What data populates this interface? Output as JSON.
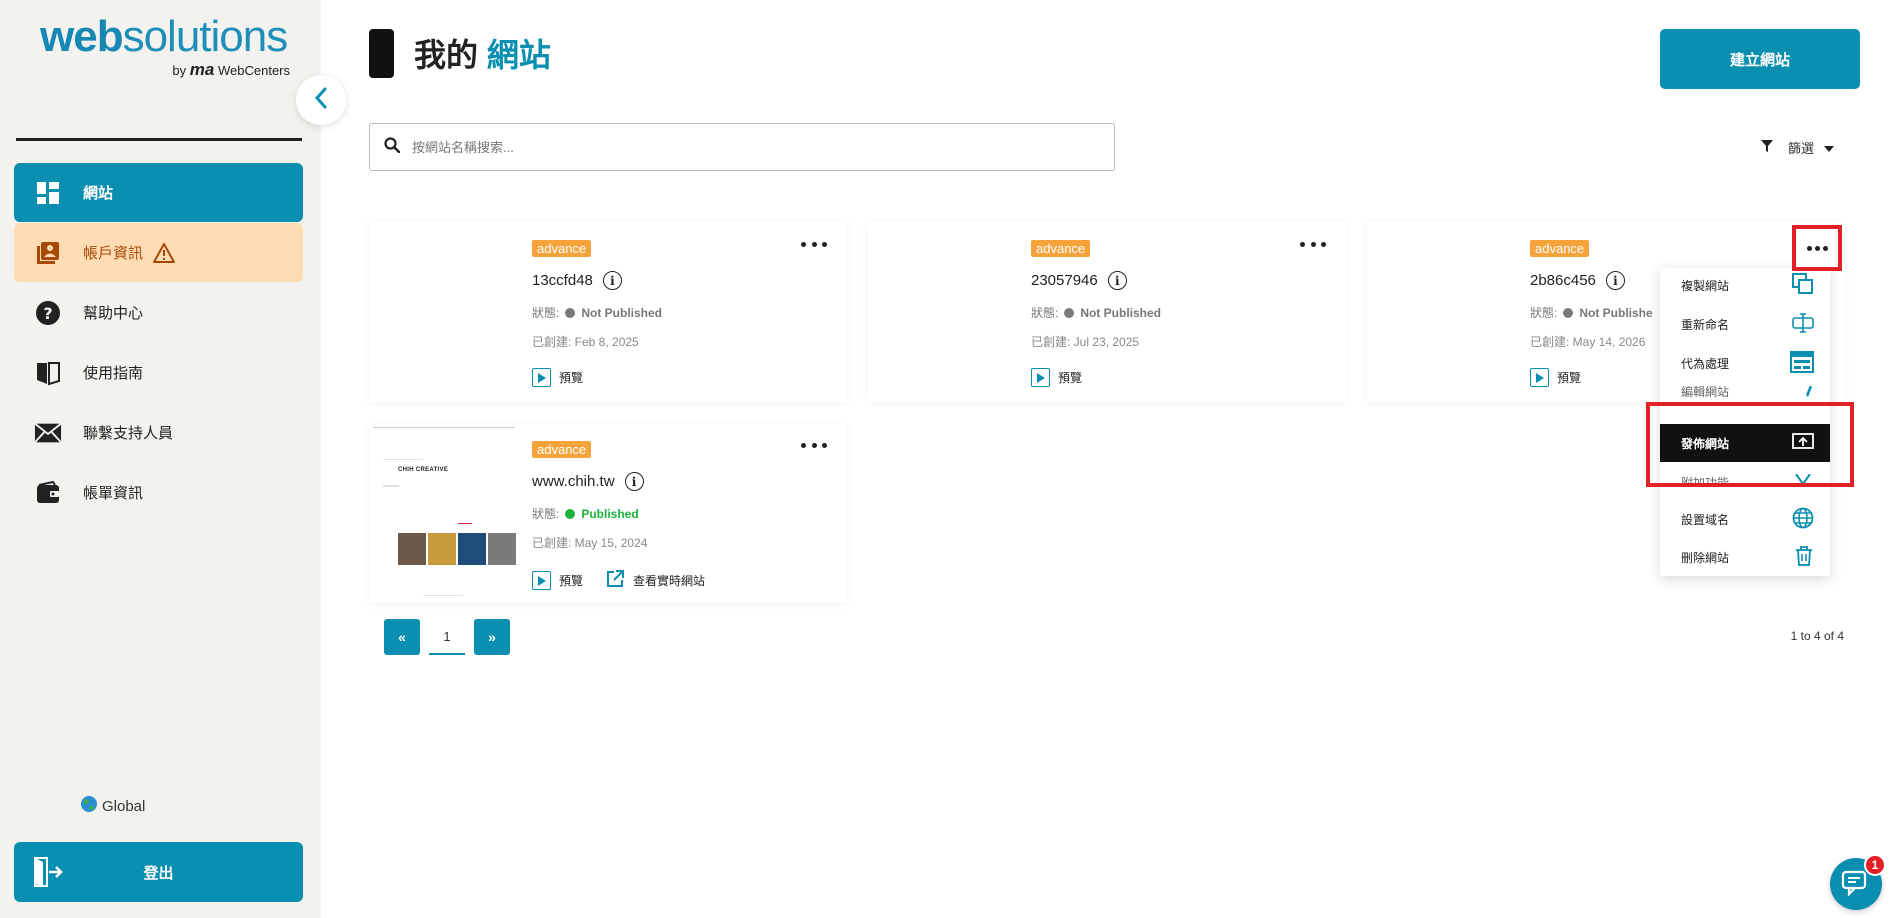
{
  "sidebar": {
    "logo_web": "web",
    "logo_solutions": "solutions",
    "logo_by": "by",
    "logo_ma": "ma",
    "logo_webcenters": "WebCenters",
    "items": [
      {
        "label": "網站",
        "icon": "dashboard-icon"
      },
      {
        "label": "帳戶資訊",
        "icon": "account-icon"
      },
      {
        "label": "幫助中心",
        "icon": "help-icon"
      },
      {
        "label": "使用指南",
        "icon": "book-icon"
      },
      {
        "label": "聯繫支持人員",
        "icon": "mail-icon"
      },
      {
        "label": "帳單資訊",
        "icon": "wallet-icon"
      }
    ],
    "global_label": "Global",
    "logout_label": "登出"
  },
  "header": {
    "title_prefix": "我的",
    "title_accent": "網站",
    "create_button": "建立網站"
  },
  "search": {
    "placeholder": "按網站名稱搜索..."
  },
  "filter": {
    "label": "篩選"
  },
  "cards": [
    {
      "badge": "advance",
      "name": "13ccfd48",
      "status_label": "狀態:",
      "status": "Not Published",
      "created": "已創建: Feb 8, 2025",
      "preview": "預覽"
    },
    {
      "badge": "advance",
      "name": "23057946",
      "status_label": "狀態:",
      "status": "Not Published",
      "created": "已創建: Jul 23, 2025",
      "preview": "預覽"
    },
    {
      "badge": "advance",
      "name": "2b86c456",
      "status_label": "狀態:",
      "status": "Not Publishe",
      "created": "已創建: May 14, 2026",
      "preview": "預覽"
    },
    {
      "badge": "advance",
      "name": "www.chih.tw",
      "status_label": "狀態:",
      "status": "Published",
      "created": "已創建: May 15, 2024",
      "preview": "預覽",
      "live": "查看實時網站",
      "thumb_title": "CHIH CREATIVE"
    }
  ],
  "menu": {
    "items": [
      {
        "label": "複製網站",
        "icon": "copy-icon"
      },
      {
        "label": "重新命名",
        "icon": "rename-icon"
      },
      {
        "label": "代為處理",
        "icon": "layout-icon"
      },
      {
        "label": "編輯網站",
        "icon": "edit-icon"
      },
      {
        "label": "發佈網站",
        "icon": "publish-icon"
      },
      {
        "label": "附加功能",
        "icon": "addon-icon"
      },
      {
        "label": "設置域名",
        "icon": "globe-icon"
      },
      {
        "label": "刪除網站",
        "icon": "trash-icon"
      }
    ]
  },
  "pagination": {
    "prev": "«",
    "page": "1",
    "next": "»",
    "count": "1 to 4 of 4"
  },
  "chat": {
    "badge": "1"
  },
  "colors": {
    "primary": "#0b8fb0",
    "warning_bg": "#ffdcb3",
    "badge": "#f6a33c",
    "highlight": "#e32026",
    "published": "#1bb33a"
  }
}
